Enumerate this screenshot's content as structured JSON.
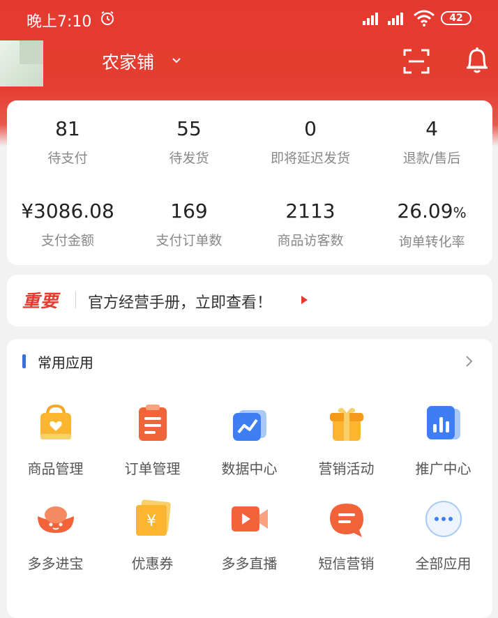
{
  "status_bar": {
    "time": "晚上7:10",
    "battery": "42"
  },
  "header": {
    "shop_name": "农家铺"
  },
  "stats": {
    "row1": [
      {
        "value": "81",
        "label": "待支付"
      },
      {
        "value": "55",
        "label": "待发货"
      },
      {
        "value": "0",
        "label": "即将延迟发货"
      },
      {
        "value": "4",
        "label": "退款/售后"
      }
    ],
    "row2": [
      {
        "value": "¥3086.08",
        "label": "支付金额"
      },
      {
        "value": "169",
        "label": "支付订单数"
      },
      {
        "value": "2113",
        "label": "商品访客数"
      },
      {
        "value": "26.09",
        "unit": "%",
        "label": "询单转化率"
      }
    ]
  },
  "notice": {
    "tag": "重要",
    "text": "官方经营手册，立即查看！"
  },
  "apps": {
    "title": "常用应用",
    "items": [
      {
        "label": "商品管理",
        "icon": "shopping-bag-icon"
      },
      {
        "label": "订单管理",
        "icon": "order-clipboard-icon"
      },
      {
        "label": "数据中心",
        "icon": "data-chart-icon"
      },
      {
        "label": "营销活动",
        "icon": "gift-box-icon"
      },
      {
        "label": "推广中心",
        "icon": "bar-chart-icon"
      },
      {
        "label": "多多进宝",
        "icon": "ingot-icon"
      },
      {
        "label": "优惠券",
        "icon": "coupon-icon"
      },
      {
        "label": "多多直播",
        "icon": "video-camera-icon"
      },
      {
        "label": "短信营销",
        "icon": "message-bubble-icon"
      },
      {
        "label": "全部应用",
        "icon": "more-dots-icon"
      }
    ]
  },
  "colors": {
    "brand_red": "#e53a2f",
    "accent_blue": "#3a6fd8"
  }
}
